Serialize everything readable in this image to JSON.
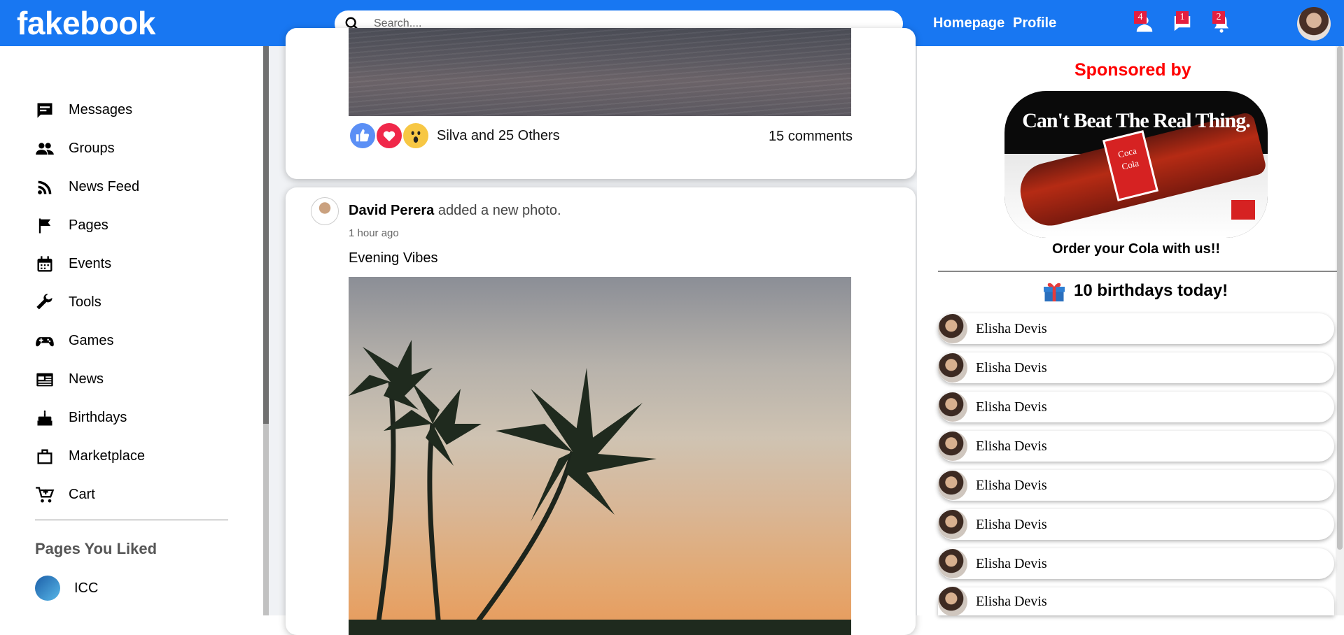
{
  "header": {
    "logo": "fakebook",
    "search_placeholder": "Search....",
    "nav": [
      "Homepage",
      "Profile"
    ],
    "badges": {
      "friends": "4",
      "messages": "1",
      "notifications": "2"
    },
    "brand_color": "#1877f2"
  },
  "sidebar": {
    "items": [
      {
        "label": "Messages",
        "icon": "messages-icon"
      },
      {
        "label": "Groups",
        "icon": "groups-icon"
      },
      {
        "label": "News Feed",
        "icon": "rss-icon"
      },
      {
        "label": "Pages",
        "icon": "flag-icon"
      },
      {
        "label": "Events",
        "icon": "calendar-icon"
      },
      {
        "label": "Tools",
        "icon": "wrench-icon"
      },
      {
        "label": "Games",
        "icon": "gamepad-icon"
      },
      {
        "label": "News",
        "icon": "newspaper-icon"
      },
      {
        "label": "Birthdays",
        "icon": "cake-icon"
      },
      {
        "label": "Marketplace",
        "icon": "briefcase-icon"
      },
      {
        "label": "Cart",
        "icon": "cart-icon"
      }
    ],
    "pages_heading": "Pages You Liked",
    "pages": [
      {
        "label": "ICC"
      }
    ]
  },
  "feed": {
    "post1": {
      "reactions_text": "Silva and 25 Others",
      "comments": "15 comments"
    },
    "post2": {
      "author": "David Perera",
      "action": " added a new photo.",
      "time": "1 hour ago",
      "caption": "Evening Vibes"
    }
  },
  "right": {
    "sponsored": "Sponsored by",
    "ad_text": "Can't Beat The Real Thing.",
    "ad_caption": "Order your Cola with us!!",
    "birthdays": "10 birthdays today!",
    "friends": [
      "Elisha Devis",
      "Elisha Devis",
      "Elisha Devis",
      "Elisha Devis",
      "Elisha Devis",
      "Elisha Devis",
      "Elisha Devis",
      "Elisha Devis"
    ]
  }
}
